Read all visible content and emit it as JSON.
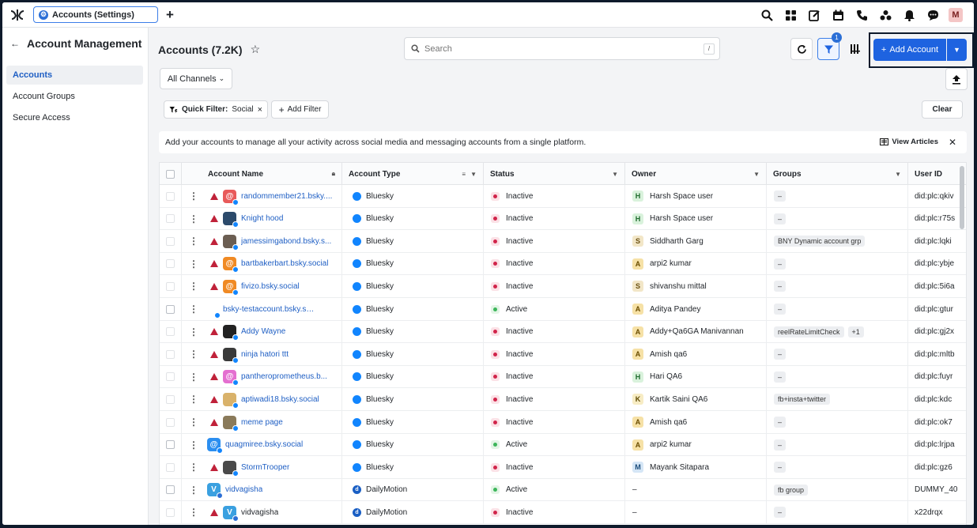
{
  "topbar": {
    "tab_label": "Accounts (Settings)",
    "avatar_initial": "M"
  },
  "sidebar": {
    "title": "Account Management",
    "items": [
      {
        "label": "Accounts",
        "active": true
      },
      {
        "label": "Account Groups",
        "active": false
      },
      {
        "label": "Secure Access",
        "active": false
      }
    ]
  },
  "header": {
    "title": "Accounts (7.2K)",
    "search_placeholder": "Search",
    "search_shortcut": "/",
    "filter_badge": "1",
    "add_account_label": "Add Account"
  },
  "filters": {
    "channels_label": "All Channels",
    "quick_filter_label": "Quick Filter:",
    "quick_filter_value": "Social",
    "add_filter_label": "Add Filter",
    "clear_label": "Clear"
  },
  "banner": {
    "text": "Add your accounts to manage all your activity across social media and messaging accounts from a single platform.",
    "view_articles": "View Articles"
  },
  "table": {
    "columns": [
      "Account Name",
      "Account Type",
      "Status",
      "Owner",
      "Groups",
      "User ID"
    ],
    "rows": [
      {
        "name": "randommember21.bsky....",
        "type": "Bluesky",
        "status": "Inactive",
        "owner": "Harsh Space user",
        "owner_initial": "H",
        "groups": [
          "–"
        ],
        "user_id": "did:plc:qkiv",
        "warn": true,
        "av_color": "#e85a5a",
        "av_text": "@"
      },
      {
        "name": "Knight hood",
        "type": "Bluesky",
        "status": "Inactive",
        "owner": "Harsh Space user",
        "owner_initial": "H",
        "groups": [
          "–"
        ],
        "user_id": "did:plc:r75s",
        "warn": true,
        "av_color": "#2c4a6b",
        "av_text": ""
      },
      {
        "name": "jamessimgabond.bsky.s...",
        "type": "Bluesky",
        "status": "Inactive",
        "owner": "Siddharth Garg",
        "owner_initial": "S",
        "groups": [
          "BNY Dynamic account grp"
        ],
        "user_id": "did:plc:lqki",
        "warn": true,
        "av_color": "#6b5e52",
        "av_text": ""
      },
      {
        "name": "bartbakerbart.bsky.social",
        "type": "Bluesky",
        "status": "Inactive",
        "owner": "arpi2 kumar",
        "owner_initial": "A",
        "groups": [
          "–"
        ],
        "user_id": "did:plc:ybje",
        "warn": true,
        "av_color": "#f08a24",
        "av_text": "@"
      },
      {
        "name": "fivizo.bsky.social",
        "type": "Bluesky",
        "status": "Inactive",
        "owner": "shivanshu mittal",
        "owner_initial": "S",
        "groups": [
          "–"
        ],
        "user_id": "did:plc:5i6a",
        "warn": true,
        "av_color": "#f08a24",
        "av_text": "@"
      },
      {
        "name": "bsky-testaccount.bsky.social",
        "type": "Bluesky",
        "status": "Active",
        "owner": "Aditya Pandey",
        "owner_initial": "A",
        "groups": [
          "–"
        ],
        "user_id": "did:plc:gtur",
        "warn": false,
        "av_color": "",
        "av_text": ""
      },
      {
        "name": "Addy Wayne",
        "type": "Bluesky",
        "status": "Inactive",
        "owner": "Addy+Qa6GA Manivannan",
        "owner_initial": "A",
        "groups": [
          "reelRateLimitCheck",
          "+1"
        ],
        "user_id": "did:plc:gj2x",
        "warn": true,
        "av_color": "#222222",
        "av_text": ""
      },
      {
        "name": "ninja hatori ttt",
        "type": "Bluesky",
        "status": "Inactive",
        "owner": "Amish qa6",
        "owner_initial": "A",
        "groups": [
          "–"
        ],
        "user_id": "did:plc:mltb",
        "warn": true,
        "av_color": "#3a3a3a",
        "av_text": ""
      },
      {
        "name": "pantheroprometheus.b...",
        "type": "Bluesky",
        "status": "Inactive",
        "owner": "Hari QA6",
        "owner_initial": "H",
        "groups": [
          "–"
        ],
        "user_id": "did:plc:fuyr",
        "warn": true,
        "av_color": "#e46fd0",
        "av_text": "@"
      },
      {
        "name": "aptiwadi18.bsky.social",
        "type": "Bluesky",
        "status": "Inactive",
        "owner": "Kartik Saini QA6",
        "owner_initial": "K",
        "groups": [
          "fb+insta+twitter"
        ],
        "user_id": "did:plc:kdc",
        "warn": true,
        "av_color": "#d9b26a",
        "av_text": ""
      },
      {
        "name": "meme page",
        "type": "Bluesky",
        "status": "Inactive",
        "owner": "Amish qa6",
        "owner_initial": "A",
        "groups": [
          "–"
        ],
        "user_id": "did:plc:ok7",
        "warn": true,
        "av_color": "#8a7a5a",
        "av_text": ""
      },
      {
        "name": "quagmiree.bsky.social",
        "type": "Bluesky",
        "status": "Active",
        "owner": "arpi2 kumar",
        "owner_initial": "A",
        "groups": [
          "–"
        ],
        "user_id": "did:plc:lrjpa",
        "warn": false,
        "av_color": "#2b8ef0",
        "av_text": "@"
      },
      {
        "name": "StormTrooper",
        "type": "Bluesky",
        "status": "Inactive",
        "owner": "Mayank Sitapara",
        "owner_initial": "M",
        "groups": [
          "–"
        ],
        "user_id": "did:plc:gz6",
        "warn": true,
        "av_color": "#4a4a4a",
        "av_text": ""
      },
      {
        "name": "vidvagisha",
        "type": "DailyMotion",
        "status": "Active",
        "owner": "–",
        "owner_initial": "",
        "groups": [
          "fb group"
        ],
        "user_id": "DUMMY_40",
        "warn": false,
        "av_color": "#3aa0e0",
        "av_text": "V"
      },
      {
        "name": "vidvagisha",
        "type": "DailyMotion",
        "status": "Inactive",
        "owner": "–",
        "owner_initial": "",
        "groups": [
          "–"
        ],
        "user_id": "x22drqx",
        "warn": true,
        "av_color": "#3aa0e0",
        "av_text": "V"
      }
    ]
  }
}
